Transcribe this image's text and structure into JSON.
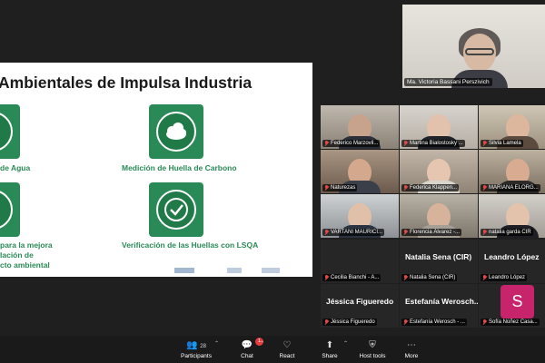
{
  "slide": {
    "title": "Ambientales de Impulsa Industria",
    "labels": {
      "agua": "de Agua",
      "carbono": "Medición de Huella de Carbono",
      "mejora_1": "para la mejora",
      "mejora_2": "lación de",
      "mejora_3": "cto ambiental",
      "verificacion": "Verificación de las Huellas con LSQA"
    },
    "accent_color": "#2a8a57"
  },
  "presenter": {
    "name": "Ma. Victoria Bassani Perszivich"
  },
  "participants": [
    {
      "name": "Federico Marzovil..."
    },
    {
      "name": "Martina Bialostosky ..."
    },
    {
      "name": "Silvia Lamela"
    },
    {
      "name": "Naturezas"
    },
    {
      "name": "Federica Klappen..."
    },
    {
      "name": "MARIANA ELORG..."
    },
    {
      "name": "VARTANI MAURICI..."
    },
    {
      "name": "Florencia Álvarez -..."
    },
    {
      "name": "natalia garda CIR"
    }
  ],
  "text_tiles": [
    {
      "display": "",
      "name": "Cecilia Bianchi - A..."
    },
    {
      "display": "Natalia Sena (CIR)",
      "name": "Natalia Sena (CIR)"
    },
    {
      "display": "Leandro López",
      "name": "Leandro López"
    },
    {
      "display": "Jéssica Figueredo",
      "name": "Jéssica Figueredo"
    },
    {
      "display": "Estefanía Werosch...",
      "name": "Estefanía Werosch - ..."
    },
    {
      "display": "",
      "name": "Sofía Núñez Casa..."
    }
  ],
  "avatar_initial": "S",
  "avatar_color": "#c7246b",
  "toolbar": {
    "participants_label": "Participants",
    "participants_count": "28",
    "chat_label": "Chat",
    "chat_badge": "1",
    "react_label": "React",
    "share_label": "Share",
    "host_tools_label": "Host tools",
    "more_label": "More"
  }
}
